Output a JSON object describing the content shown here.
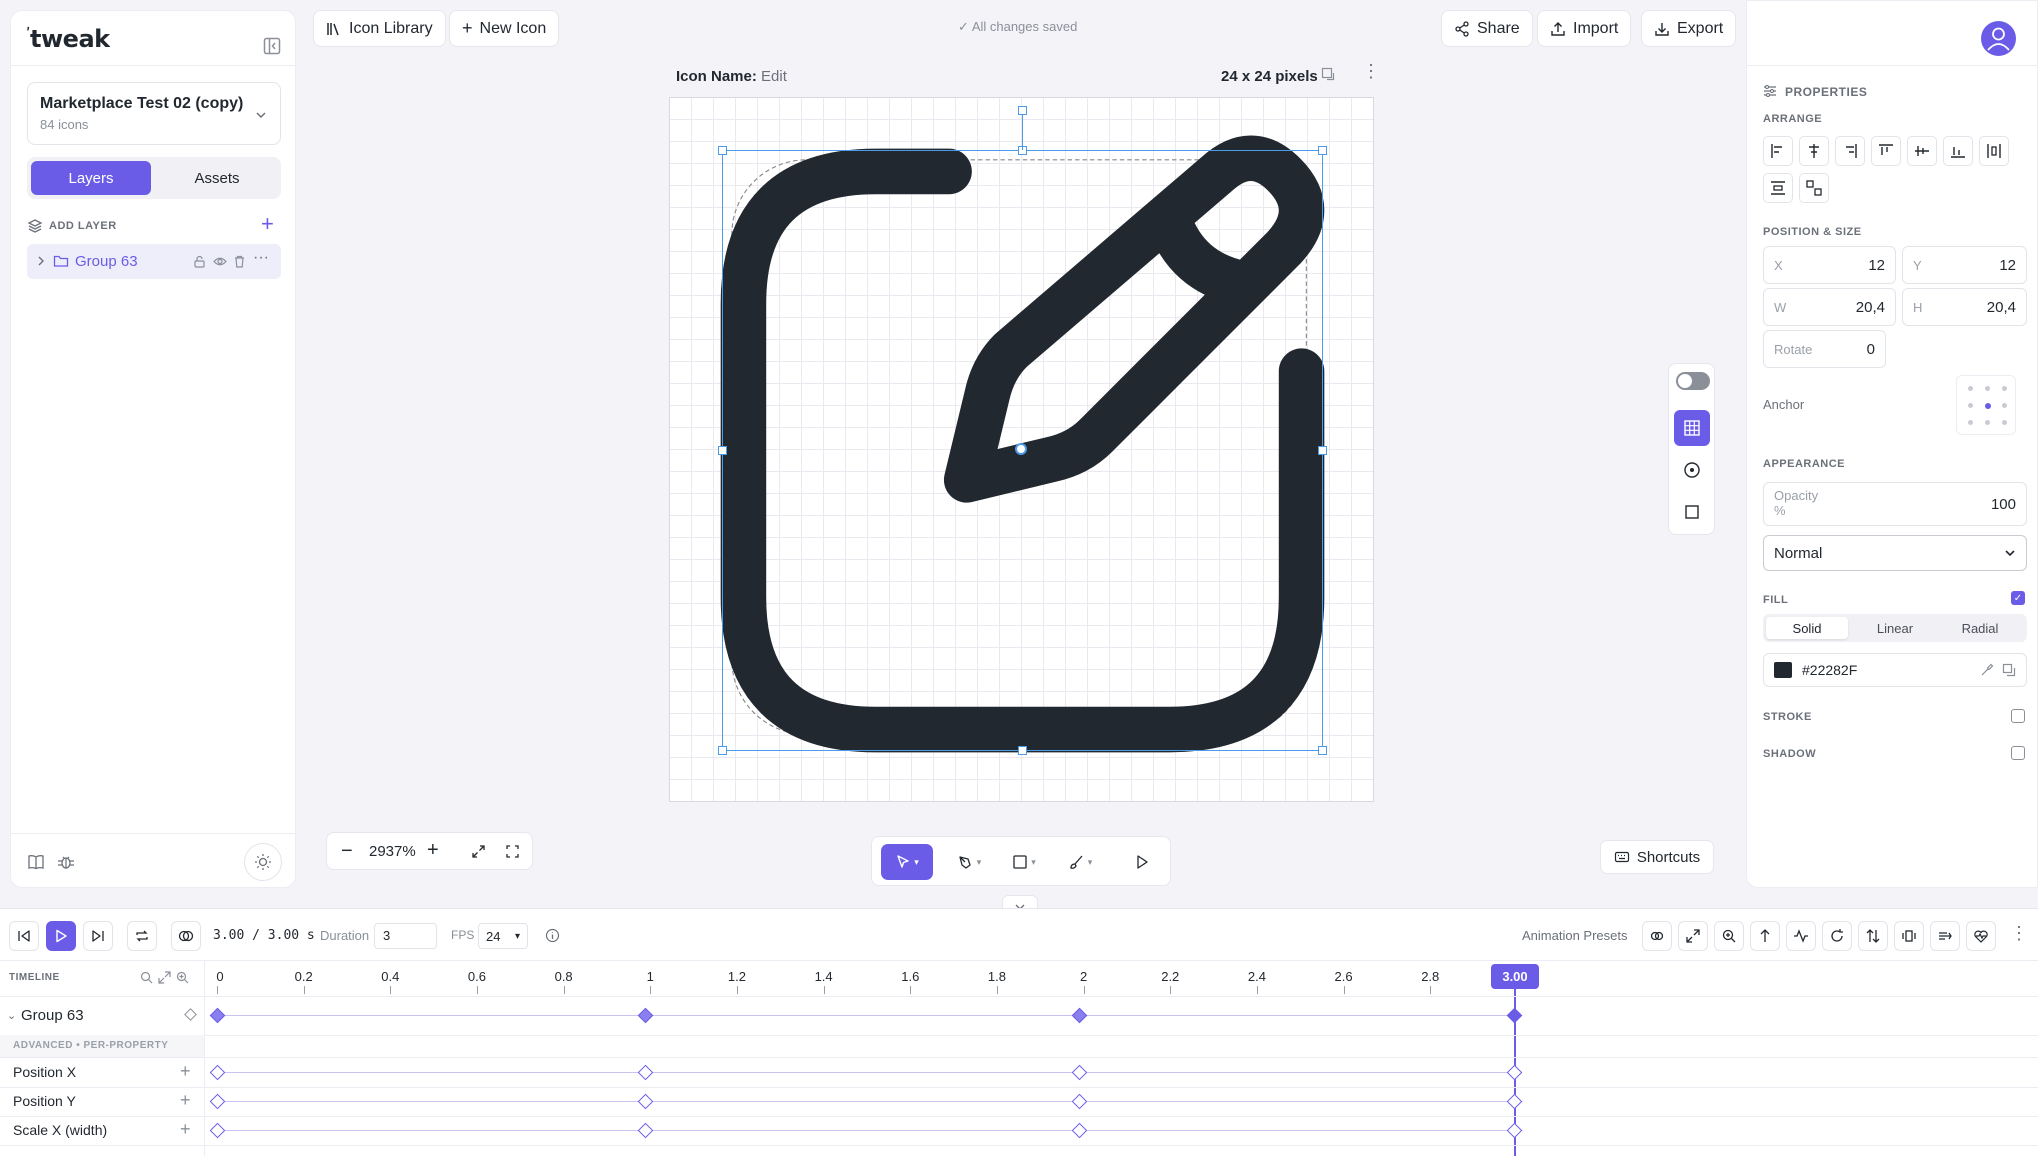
{
  "app": {
    "logo": "tweak"
  },
  "header": {
    "icon_library": "Icon Library",
    "new_icon": "New Icon",
    "save_status": "All changes saved",
    "share": "Share",
    "import": "Import",
    "export": "Export"
  },
  "project": {
    "name": "Marketplace Test 02 (copy)",
    "count": "84 icons"
  },
  "left_tabs": {
    "layers": "Layers",
    "assets": "Assets"
  },
  "layers": {
    "add_layer": "ADD LAYER",
    "items": [
      {
        "name": "Group 63"
      }
    ]
  },
  "canvas": {
    "icon_name_label": "Icon Name:",
    "icon_name_value": "Edit",
    "size_label": "24 x 24 pixels",
    "zoom": "2937%",
    "fill_color": "#22282F"
  },
  "shortcuts": "Shortcuts",
  "properties": {
    "title": "PROPERTIES",
    "arrange": "ARRANGE",
    "position_size": "POSITION & SIZE",
    "x_label": "X",
    "x_value": "12",
    "y_label": "Y",
    "y_value": "12",
    "w_label": "W",
    "w_value": "20,4",
    "h_label": "H",
    "h_value": "20,4",
    "rotate_label": "Rotate",
    "rotate_value": "0",
    "anchor_label": "Anchor",
    "appearance": "APPEARANCE",
    "opacity_label": "Opacity",
    "opacity_unit": "%",
    "opacity_value": "100",
    "blend_mode": "Normal",
    "fill": "FILL",
    "fill_tabs": [
      "Solid",
      "Linear",
      "Radial"
    ],
    "fill_hex": "#22282F",
    "stroke": "STROKE",
    "shadow": "SHADOW"
  },
  "timeline": {
    "time": "3.00 / 3.00 s",
    "duration_label": "Duration",
    "duration_value": "3",
    "fps_label": "FPS",
    "fps_value": "24",
    "presets": "Animation Presets",
    "title": "TIMELINE",
    "current_time": "3.00",
    "ticks": [
      "0",
      "0.2",
      "0.4",
      "0.6",
      "0.8",
      "1",
      "1.2",
      "1.4",
      "1.6",
      "1.8",
      "2",
      "2.2",
      "2.4",
      "2.6",
      "2.8"
    ],
    "group_row": "Group 63",
    "advanced": "ADVANCED • PER-PROPERTY",
    "properties": [
      "Position X",
      "Position Y",
      "Scale X (width)"
    ]
  },
  "colors": {
    "accent": "#6b5ce7",
    "icon": "#22282F",
    "selection": "#4a9be8"
  }
}
